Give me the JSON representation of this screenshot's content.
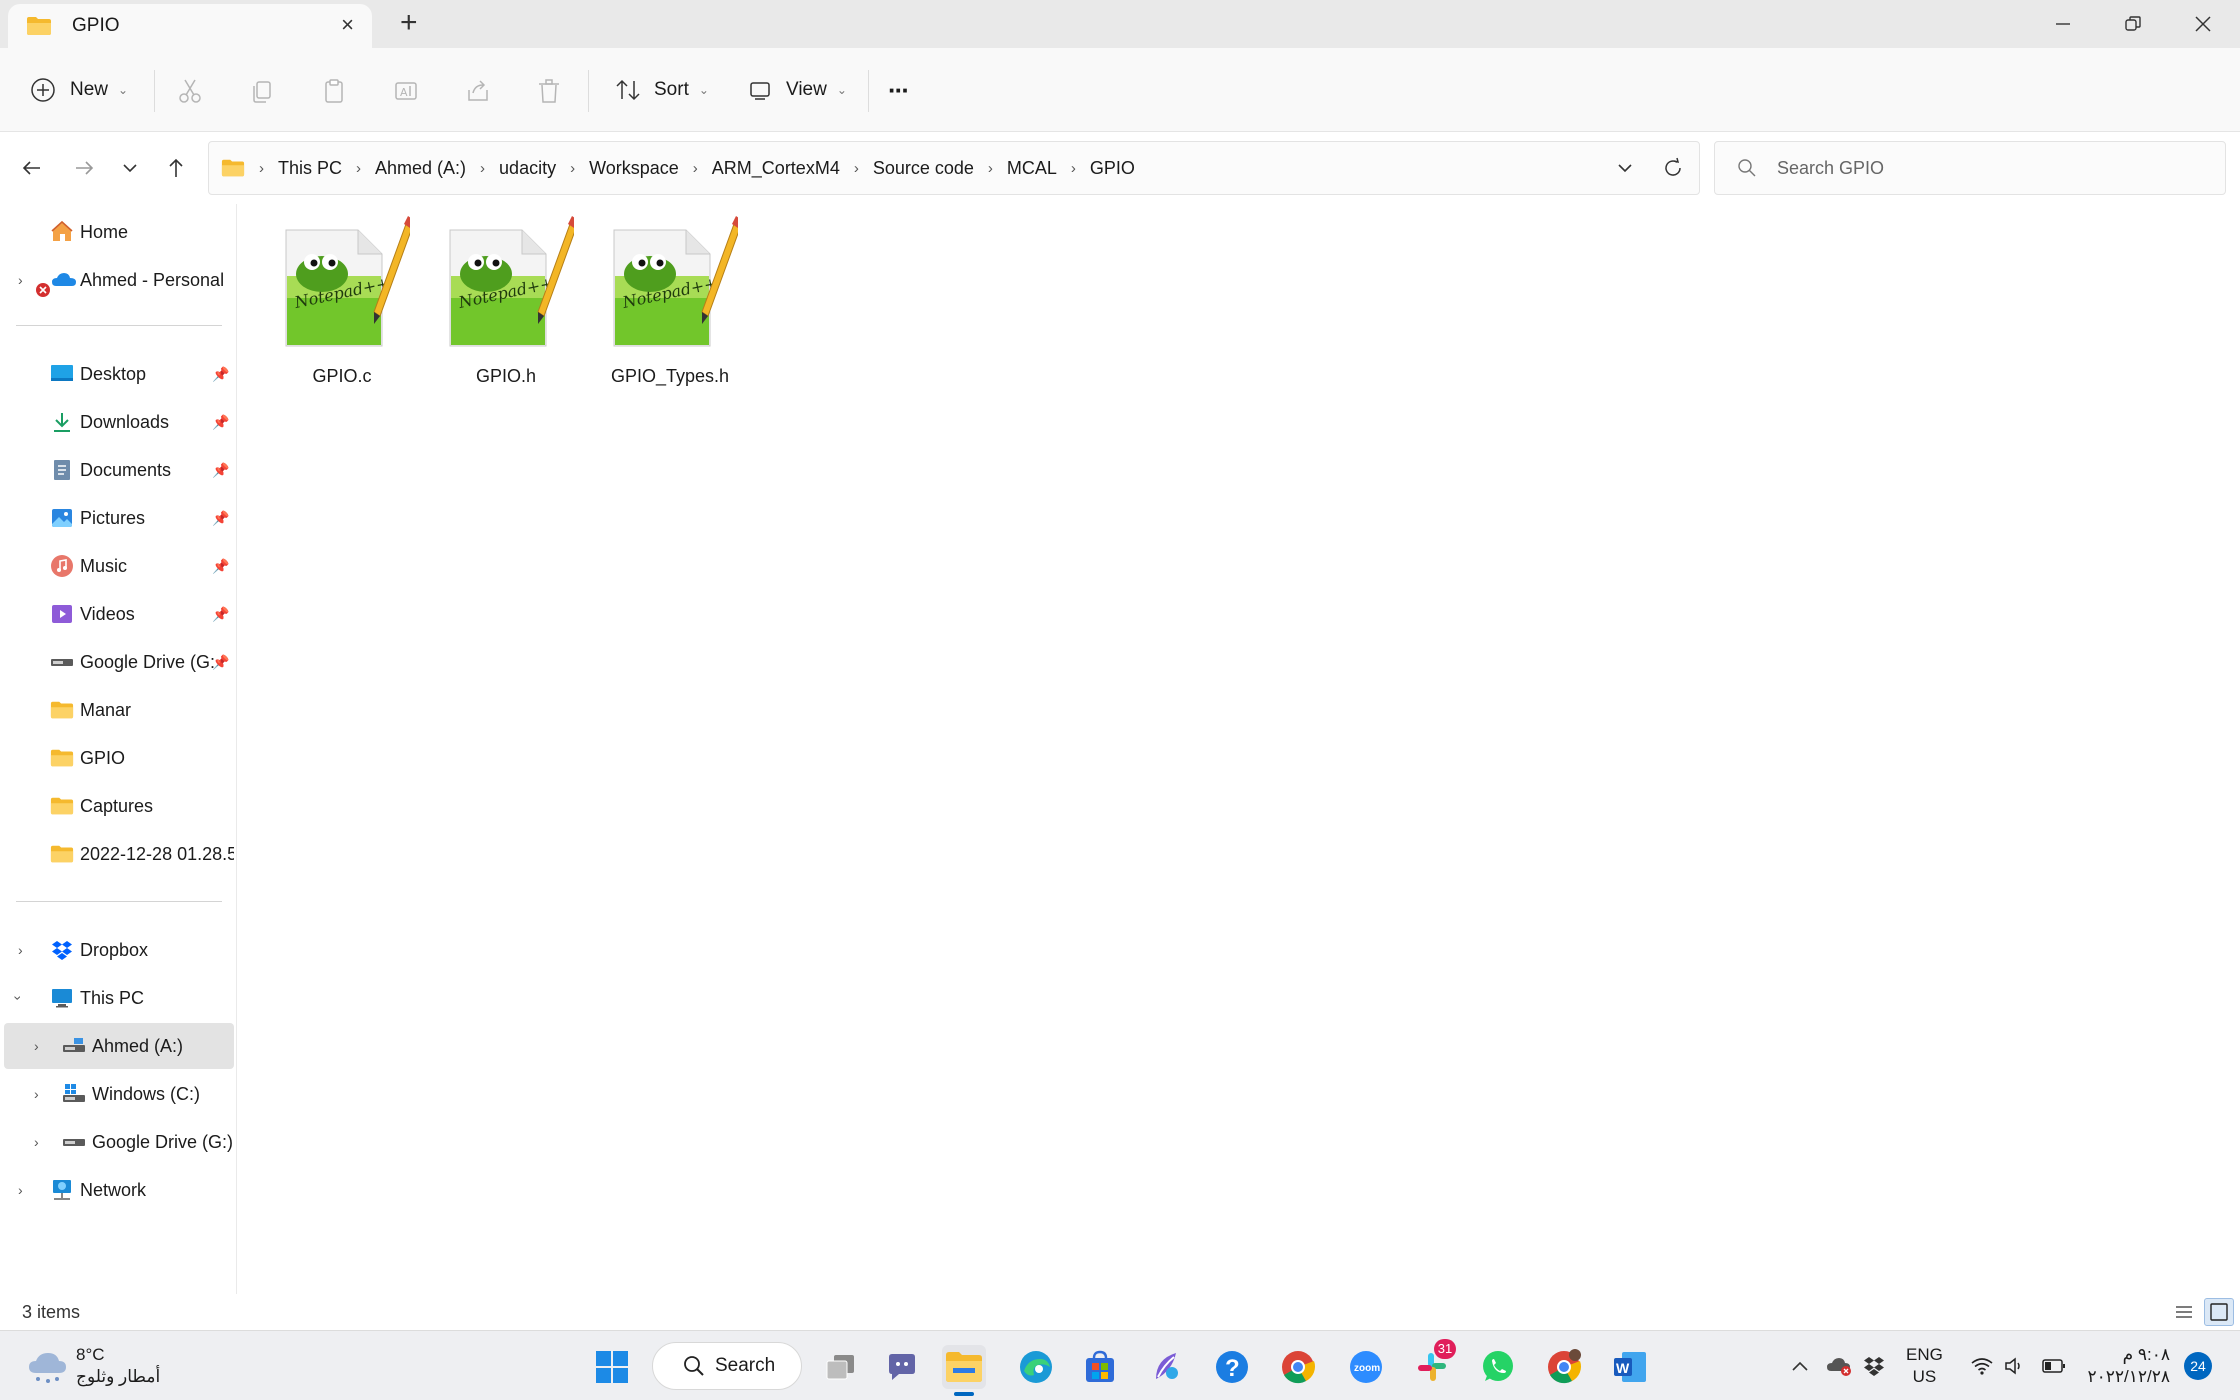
{
  "window": {
    "tab_title": "GPIO",
    "new_tab_symbol": "+",
    "close_tab_symbol": "×"
  },
  "toolbar": {
    "new_label": "New",
    "sort_label": "Sort",
    "view_label": "View",
    "more_label": "···"
  },
  "address": {
    "breadcrumbs": [
      "This PC",
      "Ahmed (A:)",
      "udacity",
      "Workspace",
      "ARM_CortexM4",
      "Source code",
      "MCAL",
      "GPIO"
    ],
    "search_placeholder": "Search GPIO"
  },
  "sidebar": {
    "home": "Home",
    "personal": "Ahmed - Personal",
    "quick_access": [
      {
        "label": "Desktop",
        "icon": "desktop-icon"
      },
      {
        "label": "Downloads",
        "icon": "downloads-icon"
      },
      {
        "label": "Documents",
        "icon": "documents-icon"
      },
      {
        "label": "Pictures",
        "icon": "pictures-icon"
      },
      {
        "label": "Music",
        "icon": "music-icon"
      },
      {
        "label": "Videos",
        "icon": "videos-icon"
      },
      {
        "label": "Google Drive (G:",
        "icon": "drive-icon"
      },
      {
        "label": "Manar",
        "icon": "folder-icon"
      },
      {
        "label": "GPIO",
        "icon": "folder-icon"
      },
      {
        "label": "Captures",
        "icon": "folder-icon"
      },
      {
        "label": "2022-12-28 01.28.5",
        "icon": "folder-icon"
      }
    ],
    "dropbox": "Dropbox",
    "this_pc": "This PC",
    "drives": [
      "Ahmed (A:)",
      "Windows (C:)",
      "Google Drive (G:)"
    ],
    "network": "Network"
  },
  "files": [
    {
      "name": "GPIO.c"
    },
    {
      "name": "GPIO.h"
    },
    {
      "name": "GPIO_Types.h"
    }
  ],
  "status": {
    "item_count": "3 items"
  },
  "taskbar": {
    "search_label": "Search",
    "weather_temp": "8°C",
    "weather_desc": "أمطار وثلوج",
    "slack_badge": "31",
    "lang_top": "ENG",
    "lang_bottom": "US",
    "time": "٩:٠٨ م",
    "date": "٢٠٢٢/١٢/٢٨",
    "notif_count": "24"
  },
  "colors": {
    "accent": "#0067c0",
    "folder": "#f8c84a",
    "selected": "#e3e3e3"
  }
}
